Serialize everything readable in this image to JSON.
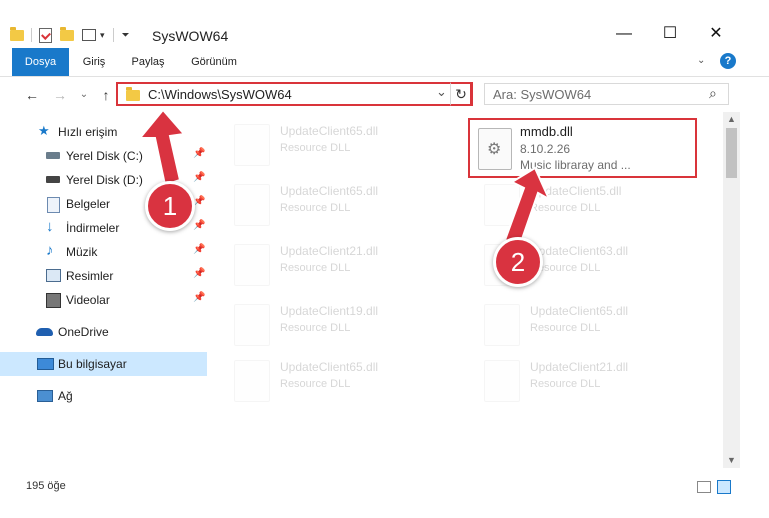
{
  "window": {
    "title": "SysWOW64",
    "controls": {
      "minimize": "—",
      "maximize": "☐",
      "close": "✕"
    }
  },
  "ribbon": {
    "tabs": [
      "Dosya",
      "Giriş",
      "Paylaş",
      "Görünüm"
    ],
    "help": "?"
  },
  "nav": {
    "back": "←",
    "forward": "→",
    "recent": "⌄",
    "up": "↑",
    "address": "C:\\Windows\\SysWOW64",
    "dropdown": "⌄",
    "refresh": "↻",
    "search_placeholder": "Ara: SysWOW64",
    "search_icon": "⌕"
  },
  "sidebar": {
    "items": [
      {
        "label": "Hızlı erişim",
        "icon": "star-icon",
        "pinned": false
      },
      {
        "label": "Yerel Disk (C:)",
        "icon": "drive-icon",
        "pinned": true
      },
      {
        "label": "Yerel Disk (D:)",
        "icon": "drive-icon",
        "pinned": true
      },
      {
        "label": "Belgeler",
        "icon": "documents-icon",
        "pinned": true
      },
      {
        "label": "İndirmeler",
        "icon": "download-icon",
        "pinned": true
      },
      {
        "label": "Müzik",
        "icon": "music-icon",
        "pinned": true
      },
      {
        "label": "Resimler",
        "icon": "pictures-icon",
        "pinned": true
      },
      {
        "label": "Videolar",
        "icon": "videos-icon",
        "pinned": true
      },
      {
        "label": "OneDrive",
        "icon": "cloud-icon",
        "pinned": false
      },
      {
        "label": "Bu bilgisayar",
        "icon": "computer-icon",
        "pinned": false
      },
      {
        "label": "Ağ",
        "icon": "network-icon",
        "pinned": false
      }
    ],
    "pin_glyph": "📌"
  },
  "files": {
    "highlighted": {
      "name": "mmdb.dll",
      "version": "8.10.2.26",
      "description": "Music libraray and ..."
    },
    "left_column": [
      {
        "name": "UpdateClient65.dll",
        "type": "Resource DLL"
      },
      {
        "name": "UpdateClient65.dll",
        "type": "Resource DLL"
      },
      {
        "name": "UpdateClient21.dll",
        "type": "Resource DLL"
      },
      {
        "name": "UpdateClient19.dll",
        "type": "Resource DLL"
      },
      {
        "name": "UpdateClient65.dll",
        "type": "Resource DLL"
      }
    ],
    "right_column": [
      {
        "name": "UpdateClient5.dll",
        "type": "Resource DLL"
      },
      {
        "name": "UpdateClient63.dll",
        "type": "Resource DLL"
      },
      {
        "name": "UpdateClient65.dll",
        "type": "Resource DLL"
      },
      {
        "name": "UpdateClient21.dll",
        "type": "Resource DLL"
      }
    ]
  },
  "status": {
    "count": "195 öğe"
  },
  "callouts": [
    "1",
    "2"
  ],
  "colors": {
    "accent": "#1979ca",
    "highlight_red": "#d9343a",
    "selected_bg": "#cce8ff",
    "callout": "#d93340"
  }
}
